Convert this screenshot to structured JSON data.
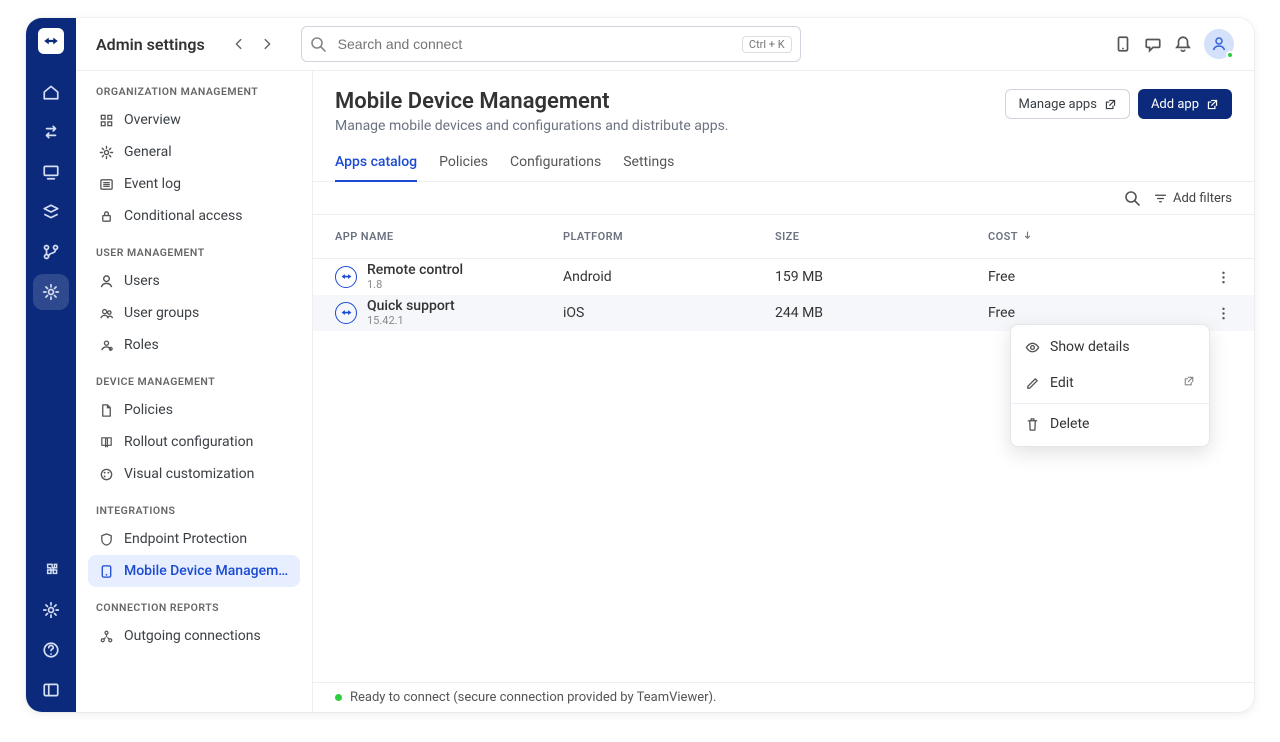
{
  "header": {
    "title": "Admin settings",
    "search_placeholder": "Search and connect",
    "search_shortcut": "Ctrl + K"
  },
  "sidebar": {
    "sections": [
      {
        "title": "ORGANIZATION MANAGEMENT",
        "items": [
          {
            "label": "Overview"
          },
          {
            "label": "General"
          },
          {
            "label": "Event log"
          },
          {
            "label": "Conditional access"
          }
        ]
      },
      {
        "title": "USER MANAGEMENT",
        "items": [
          {
            "label": "Users"
          },
          {
            "label": "User groups"
          },
          {
            "label": "Roles"
          }
        ]
      },
      {
        "title": "DEVICE MANAGEMENT",
        "items": [
          {
            "label": "Policies"
          },
          {
            "label": "Rollout configuration"
          },
          {
            "label": "Visual customization"
          }
        ]
      },
      {
        "title": "INTEGRATIONS",
        "items": [
          {
            "label": "Endpoint Protection"
          },
          {
            "label": "Mobile Device Managem…",
            "active": true
          }
        ]
      },
      {
        "title": "CONNECTION REPORTS",
        "items": [
          {
            "label": "Outgoing connections"
          }
        ]
      }
    ]
  },
  "page": {
    "title": "Mobile Device Management",
    "subtitle": "Manage mobile devices and configurations and distribute apps.",
    "manage_apps": "Manage apps",
    "add_app": "Add app"
  },
  "tabs": [
    {
      "label": "Apps catalog",
      "active": true
    },
    {
      "label": "Policies"
    },
    {
      "label": "Configurations"
    },
    {
      "label": "Settings"
    }
  ],
  "toolbar": {
    "add_filters": "Add filters"
  },
  "table": {
    "headers": {
      "name": "APP NAME",
      "platform": "PLATFORM",
      "size": "SIZE",
      "cost": "COST"
    },
    "rows": [
      {
        "name": "Remote control",
        "version": "1.8",
        "platform": "Android",
        "size": "159 MB",
        "cost": "Free"
      },
      {
        "name": "Quick support",
        "version": "15.42.1",
        "platform": "iOS",
        "size": "244 MB",
        "cost": "Free"
      }
    ]
  },
  "context_menu": {
    "show": "Show details",
    "edit": "Edit",
    "delete": "Delete"
  },
  "statusbar": "Ready to connect (secure connection provided by TeamViewer).",
  "colors": {
    "brand": "#0b2a7b",
    "accent": "#1a4bd1",
    "ok": "#2ecc40"
  }
}
